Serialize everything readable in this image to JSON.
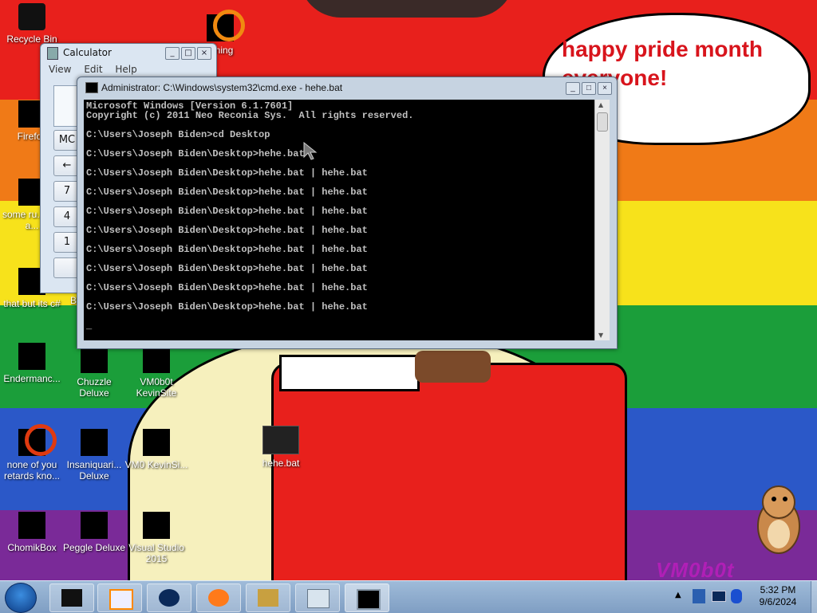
{
  "wallpaper": {
    "stripe_colors": [
      "#e8201c",
      "#f07a17",
      "#f7e21b",
      "#1b9e3a",
      "#2b58c8",
      "#7a2a98"
    ],
    "speech_bubble": "happy pride month everyone!",
    "watermark": "VM0b0t"
  },
  "desktop_icons": [
    {
      "label": "Recycle Bin"
    },
    {
      "label": "Firefox"
    },
    {
      "label": "some ru... ran a..."
    },
    {
      "label": "that but its c#"
    },
    {
      "label": "Endermanc..."
    },
    {
      "label": "Chuzzle Deluxe"
    },
    {
      "label": "VM0b0t KevinSite"
    },
    {
      "label": "none of you retards kno..."
    },
    {
      "label": "Insaniquari... Deluxe"
    },
    {
      "label": "VM0 KevinSi..."
    },
    {
      "label": "ChomikBox"
    },
    {
      "label": "Peggle Deluxe"
    },
    {
      "label": "Visual Studio 2015"
    },
    {
      "label": "hehe.bat"
    },
    {
      "label": "...ning"
    },
    {
      "label": "B"
    }
  ],
  "calculator": {
    "title": "Calculator",
    "menu": [
      "View",
      "Edit",
      "Help"
    ],
    "buttons": [
      "MC",
      "←",
      "7",
      "4",
      "1"
    ]
  },
  "cmd": {
    "title": "Administrator: C:\\Windows\\system32\\cmd.exe - hehe.bat",
    "lines": [
      "Microsoft Windows [Version 6.1.7601]",
      "Copyright (c) 2011 Neo Reconia Sys.  All rights reserved.",
      "",
      "C:\\Users\\Joseph Biden>cd Desktop",
      "",
      "C:\\Users\\Joseph Biden\\Desktop>hehe.bat",
      "",
      "C:\\Users\\Joseph Biden\\Desktop>hehe.bat | hehe.bat",
      "",
      "C:\\Users\\Joseph Biden\\Desktop>hehe.bat | hehe.bat",
      "",
      "C:\\Users\\Joseph Biden\\Desktop>hehe.bat | hehe.bat",
      "",
      "C:\\Users\\Joseph Biden\\Desktop>hehe.bat | hehe.bat",
      "",
      "C:\\Users\\Joseph Biden\\Desktop>hehe.bat | hehe.bat",
      "",
      "C:\\Users\\Joseph Biden\\Desktop>hehe.bat | hehe.bat",
      "",
      "C:\\Users\\Joseph Biden\\Desktop>hehe.bat | hehe.bat",
      "",
      "C:\\Users\\Joseph Biden\\Desktop>hehe.bat | hehe.bat",
      "",
      "_"
    ]
  },
  "taskbar": {
    "items": [
      "start-orb-icon",
      "explorer-icon",
      "media-player-icon",
      "globe-icon",
      "firefox-icon",
      "chomikbox-icon",
      "calculator-icon",
      "cmd-icon"
    ],
    "tray_icons": [
      "show-hidden-icon",
      "network-icon",
      "display-icon",
      "bluetooth-icon"
    ],
    "time": "5:32 PM",
    "date": "9/6/2024"
  }
}
